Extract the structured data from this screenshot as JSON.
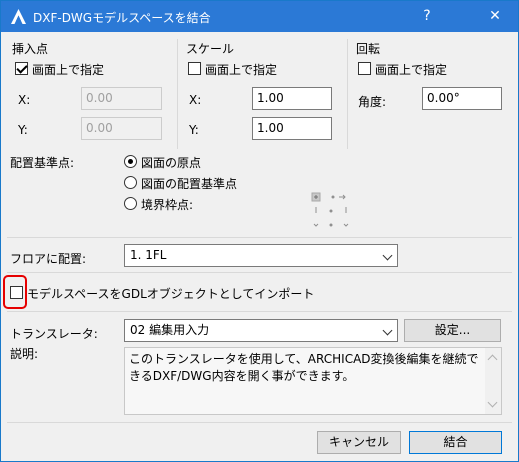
{
  "window": {
    "title": "DXF-DWGモデルスペースを結合",
    "help": "?",
    "close": "✕"
  },
  "insertion": {
    "title": "挿入点",
    "specify_label": "画面上で指定",
    "specify_checked": true,
    "x_label": "X:",
    "x_value": "0.00",
    "y_label": "Y:",
    "y_value": "0.00"
  },
  "scale": {
    "title": "スケール",
    "specify_label": "画面上で指定",
    "specify_checked": false,
    "x_label": "X:",
    "x_value": "1.00",
    "y_label": "Y:",
    "y_value": "1.00"
  },
  "rotation": {
    "title": "回転",
    "specify_label": "画面上で指定",
    "specify_checked": false,
    "angle_label": "角度:",
    "angle_value": "0.00°"
  },
  "placement": {
    "label": "配置基準点:",
    "options": [
      "図面の原点",
      "図面の配置基準点",
      "境界枠点:"
    ],
    "selected_index": 0
  },
  "floor": {
    "label": "フロアに配置:",
    "value": "1. 1FL"
  },
  "gdl": {
    "label": "モデルスペースをGDLオブジェクトとしてインポート",
    "checked": false
  },
  "translator": {
    "label": "トランスレータ:",
    "value": "02 編集用入力",
    "settings_button": "設定..."
  },
  "description": {
    "label": "説明:",
    "text": "このトランスレータを使用して、ARCHICAD変換後編集を継続できるDXF/DWG内容を開く事ができます。"
  },
  "buttons": {
    "cancel": "キャンセル",
    "merge": "結合"
  },
  "colors": {
    "titlebar": "#2b79d6",
    "accent": "#0078d7",
    "highlight": "#e60000"
  }
}
